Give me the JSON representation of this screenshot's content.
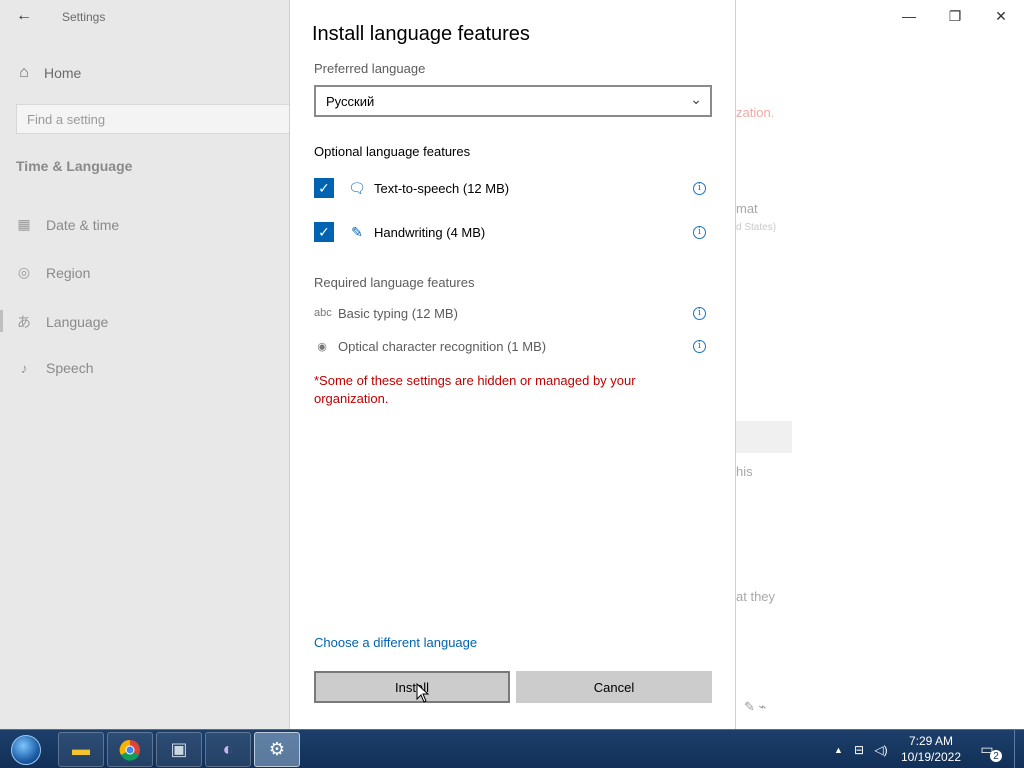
{
  "settings": {
    "title": "Settings",
    "back_icon": "back-arrow-icon",
    "home_label": "Home",
    "search_placeholder": "Find a setting",
    "section_title": "Time & Language",
    "nav": [
      {
        "label": "Date & time",
        "icon": "calendar-clock-icon"
      },
      {
        "label": "Region",
        "icon": "globe-icon"
      },
      {
        "label": "Language",
        "icon": "language-icon"
      },
      {
        "label": "Speech",
        "icon": "microphone-icon"
      }
    ]
  },
  "background": {
    "partial_red": "zation.",
    "partial_format": "mat",
    "partial_states": "d States)",
    "partial_this": "his",
    "partial_they": "at they"
  },
  "dialog": {
    "title": "Install language features",
    "preferred_label": "Preferred language",
    "preferred_value": "Русский",
    "optional_label": "Optional language features",
    "optional": [
      {
        "label": "Text-to-speech (12 MB)",
        "checked": true,
        "icon": "speech-icon"
      },
      {
        "label": "Handwriting (4 MB)",
        "checked": true,
        "icon": "handwriting-icon"
      }
    ],
    "required_label": "Required language features",
    "required": [
      {
        "label": "Basic typing (12 MB)",
        "icon": "keyboard-abc-icon"
      },
      {
        "label": "Optical character recognition (1 MB)",
        "icon": "ocr-icon"
      }
    ],
    "managed_note": "*Some of these settings are hidden or managed by your organization.",
    "choose_link": "Choose a different language",
    "install_label": "Install",
    "cancel_label": "Cancel"
  },
  "taskbar": {
    "apps": [
      "file-explorer",
      "chrome",
      "system-tool",
      "media-player",
      "settings"
    ],
    "time": "7:29 AM",
    "date": "10/19/2022",
    "notification_count": "2"
  },
  "colors": {
    "accent": "#0063b1",
    "warning": "#c00000",
    "taskbar": "#123058"
  }
}
